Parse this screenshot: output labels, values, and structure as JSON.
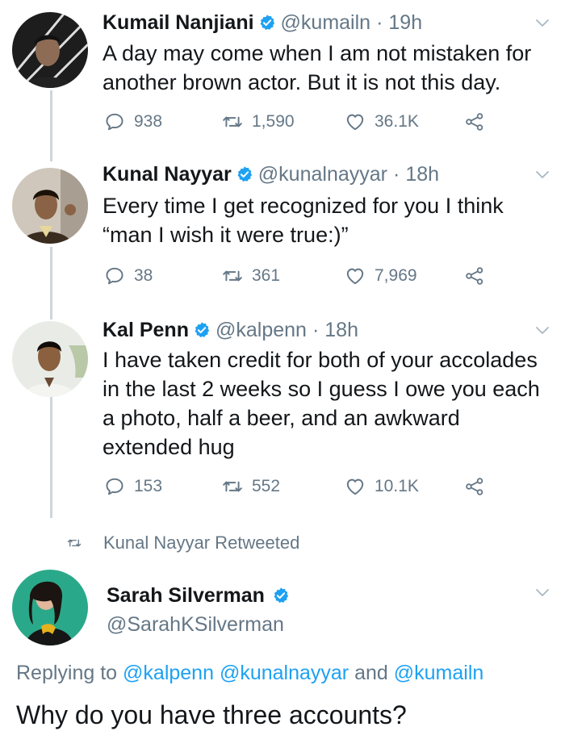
{
  "tweets": [
    {
      "name": "Kumail Nanjiani",
      "handle": "@kumailn",
      "time": "19h",
      "text_lines": [
        "A day may come when I am not mistaken for",
        "another brown actor. But it is not this day."
      ],
      "replies": "938",
      "retweets": "1,590",
      "likes": "36.1K"
    },
    {
      "name": "Kunal Nayyar",
      "handle": "@kunalnayyar",
      "time": "18h",
      "text_lines": [
        "Every time I get recognized for you I think",
        "“man I wish it were true:)”"
      ],
      "replies": "38",
      "retweets": "361",
      "likes": "7,969"
    },
    {
      "name": "Kal Penn",
      "handle": "@kalpenn",
      "time": "18h",
      "text_lines": [
        "I have taken credit for both of your accolades",
        "in the last 2 weeks so I guess I owe you each",
        "a photo, half a beer, and an awkward",
        "extended hug"
      ],
      "replies": "153",
      "retweets": "552",
      "likes": "10.1K"
    }
  ],
  "retweet_note": "Kunal Nayyar Retweeted",
  "main_tweet": {
    "name": "Sarah Silverman",
    "handle": "@SarahKSilverman",
    "replying_prefix": "Replying to",
    "mentions": [
      "@kalpenn",
      "@kunalnayyar",
      "@kumailn"
    ],
    "replying_joiner": "and",
    "text": "Why do you have three accounts?"
  },
  "colors": {
    "accent": "#1da1f2",
    "secondary_text": "#657786",
    "thread_line": "#ccd6dd"
  },
  "icons": [
    "reply-icon",
    "retweet-icon",
    "like-icon",
    "share-icon",
    "verified-badge-icon",
    "chevron-down-icon"
  ]
}
